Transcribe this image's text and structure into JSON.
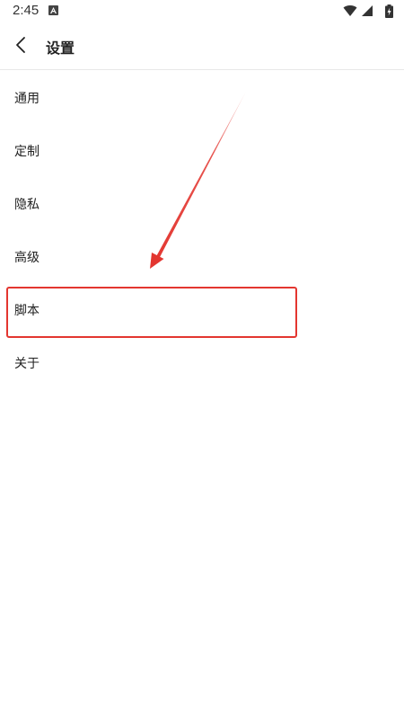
{
  "status_bar": {
    "time": "2:45",
    "notification_icon": "a-icon",
    "icons": [
      "wifi-icon",
      "cellular-signal-icon",
      "battery-charging-icon"
    ]
  },
  "header": {
    "back_icon": "chevron-left-icon",
    "title": "设置"
  },
  "settings": {
    "items": [
      {
        "label": "通用"
      },
      {
        "label": "定制"
      },
      {
        "label": "隐私"
      },
      {
        "label": "高级"
      },
      {
        "label": "脚本"
      },
      {
        "label": "关于"
      }
    ]
  },
  "annotation": {
    "highlight_color": "#e33630",
    "highlighted_item": "脚本"
  }
}
